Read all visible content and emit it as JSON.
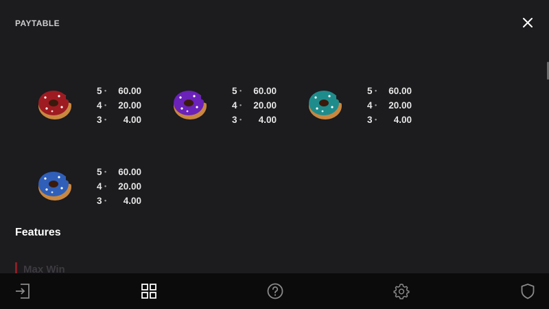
{
  "header": {
    "title": "PAYTABLE"
  },
  "paytable": {
    "items": [
      {
        "symbol": "red-donut-icon",
        "color": "#9e1b22",
        "rows": [
          {
            "count": "5",
            "value": "60.00"
          },
          {
            "count": "4",
            "value": "20.00"
          },
          {
            "count": "3",
            "value": "4.00"
          }
        ]
      },
      {
        "symbol": "purple-donut-icon",
        "color": "#6a22b8",
        "rows": [
          {
            "count": "5",
            "value": "60.00"
          },
          {
            "count": "4",
            "value": "20.00"
          },
          {
            "count": "3",
            "value": "4.00"
          }
        ]
      },
      {
        "symbol": "teal-donut-icon",
        "color": "#1f8c8c",
        "rows": [
          {
            "count": "5",
            "value": "60.00"
          },
          {
            "count": "4",
            "value": "20.00"
          },
          {
            "count": "3",
            "value": "4.00"
          }
        ]
      },
      {
        "symbol": "blue-donut-icon",
        "color": "#2f5fb8",
        "rows": [
          {
            "count": "5",
            "value": "60.00"
          },
          {
            "count": "4",
            "value": "20.00"
          },
          {
            "count": "3",
            "value": "4.00"
          }
        ]
      }
    ]
  },
  "features": {
    "title": "Features",
    "max_win_label": "Max Win"
  },
  "bottom_nav": {
    "items": [
      "exit-icon",
      "grid-icon",
      "help-icon",
      "settings-icon",
      "shield-icon"
    ]
  },
  "colors": {
    "background": "#1c1b1e",
    "bottom_bar": "#0b0b0c",
    "accent": "#8b1f24"
  }
}
